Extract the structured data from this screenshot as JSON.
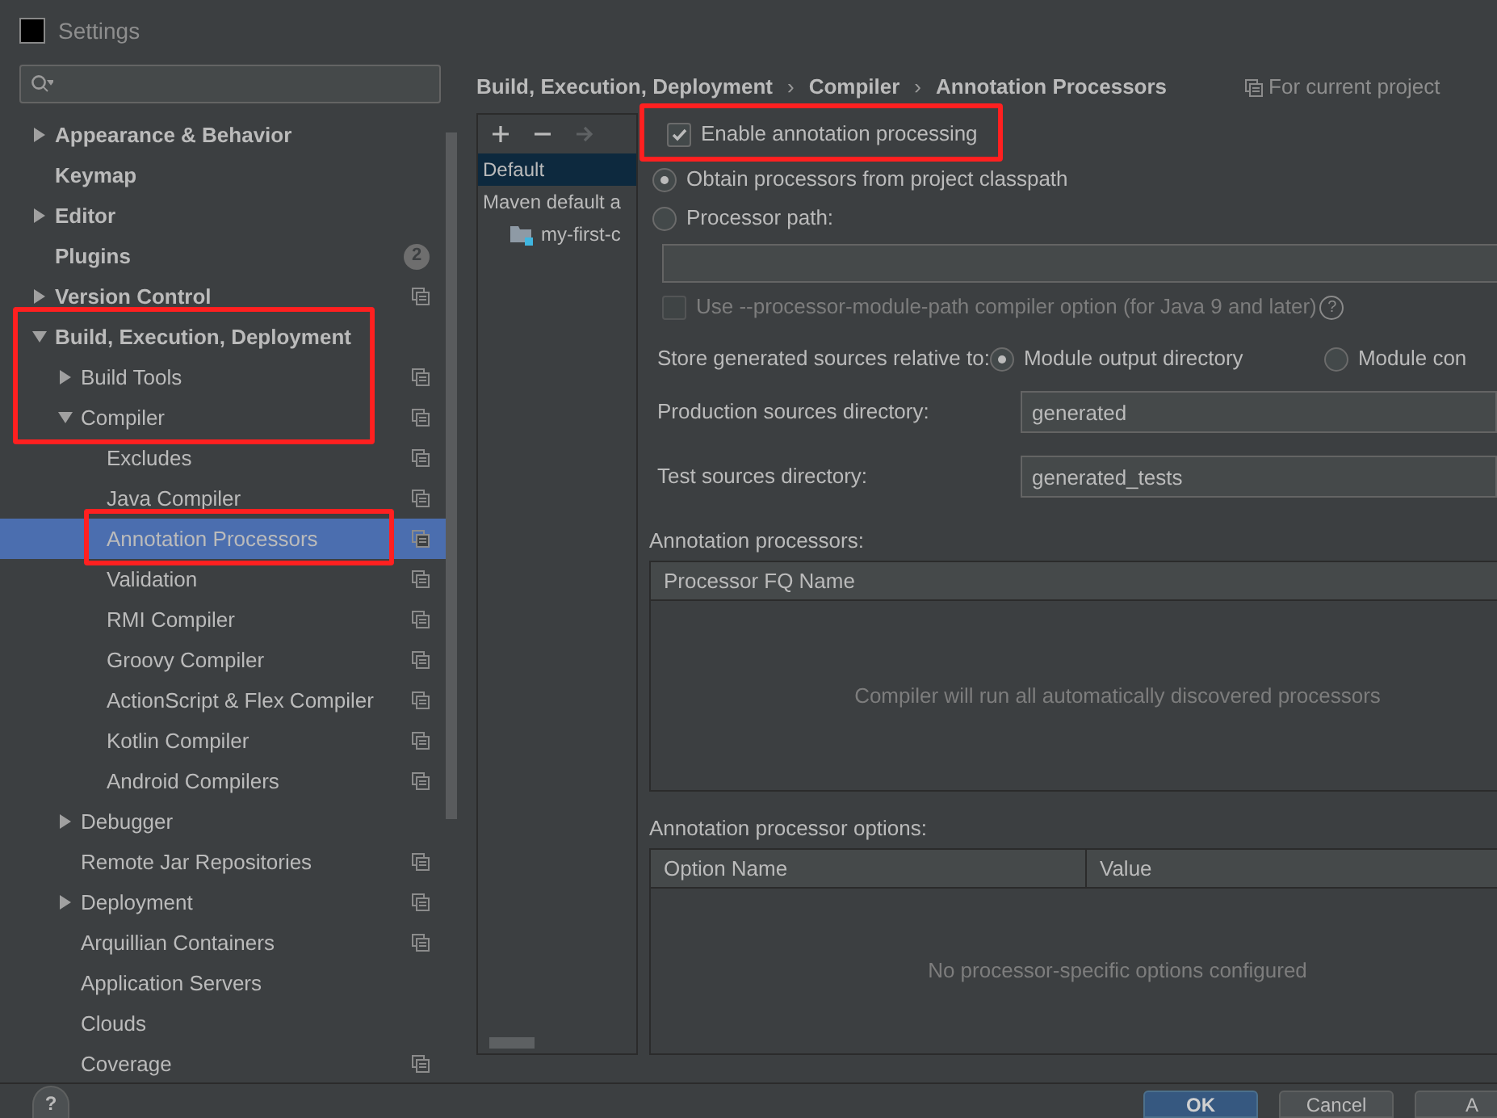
{
  "window": {
    "title": "Settings"
  },
  "tree": [
    {
      "label": "Appearance & Behavior",
      "expanded": false,
      "selected": false,
      "framed": false,
      "project_level": false
    },
    {
      "label": "Keymap",
      "selected": false,
      "framed": false,
      "project_level": false
    },
    {
      "label": "Editor",
      "expanded": false,
      "selected": false,
      "framed": false,
      "project_level": false
    },
    {
      "label": "Plugins",
      "badge": "2",
      "selected": false,
      "framed": false,
      "project_level": false
    },
    {
      "label": "Version Control",
      "expanded": false,
      "selected": false,
      "framed": false,
      "project_level": true
    },
    {
      "label": "Build, Execution, Deployment",
      "expanded": true,
      "selected": false,
      "framed": true,
      "project_level": false,
      "children": [
        {
          "label": "Build Tools",
          "expanded": false,
          "selected": false,
          "framed": true,
          "project_level": true
        },
        {
          "label": "Compiler",
          "expanded": true,
          "selected": false,
          "framed": true,
          "project_level": true,
          "children": [
            {
              "label": "Excludes",
              "selected": false,
              "framed": false,
              "project_level": true
            },
            {
              "label": "Java Compiler",
              "selected": false,
              "framed": false,
              "project_level": true
            },
            {
              "label": "Annotation Processors",
              "selected": true,
              "framed": true,
              "project_level": true
            },
            {
              "label": "Validation",
              "selected": false,
              "framed": false,
              "project_level": true
            },
            {
              "label": "RMI Compiler",
              "selected": false,
              "framed": false,
              "project_level": true
            },
            {
              "label": "Groovy Compiler",
              "selected": false,
              "framed": false,
              "project_level": true
            },
            {
              "label": "ActionScript & Flex Compiler",
              "selected": false,
              "framed": false,
              "project_level": true
            },
            {
              "label": "Kotlin Compiler",
              "selected": false,
              "framed": false,
              "project_level": true
            },
            {
              "label": "Android Compilers",
              "selected": false,
              "framed": false,
              "project_level": true
            }
          ]
        },
        {
          "label": "Debugger",
          "expanded": false,
          "selected": false,
          "framed": false,
          "project_level": false
        },
        {
          "label": "Remote Jar Repositories",
          "selected": false,
          "framed": false,
          "project_level": true
        },
        {
          "label": "Deployment",
          "expanded": false,
          "selected": false,
          "framed": false,
          "project_level": true
        },
        {
          "label": "Arquillian Containers",
          "selected": false,
          "framed": false,
          "project_level": true
        },
        {
          "label": "Application Servers",
          "selected": false,
          "framed": false,
          "project_level": false
        },
        {
          "label": "Clouds",
          "selected": false,
          "framed": false,
          "project_level": false
        },
        {
          "label": "Coverage",
          "selected": false,
          "framed": false,
          "project_level": true
        }
      ]
    }
  ],
  "breadcrumb": [
    "Build, Execution, Deployment",
    "Compiler",
    "Annotation Processors"
  ],
  "breadcrumb_separator": "›",
  "scope_label": "For current project",
  "profiles": {
    "toolbar": [
      {
        "kind": "add",
        "disabled": false
      },
      {
        "kind": "remove",
        "disabled": false
      },
      {
        "kind": "move",
        "disabled": true
      }
    ],
    "items": [
      {
        "label": "Default",
        "selected": true
      },
      {
        "label": "Maven default a",
        "selected": false,
        "children": [
          {
            "label": "my-first-c",
            "selected": false
          }
        ]
      }
    ]
  },
  "enable_processing": {
    "label": "Enable annotation processing",
    "checked": true,
    "framed": true
  },
  "source_options": [
    {
      "label": "Obtain processors from project classpath",
      "selected": true
    },
    {
      "label": "Processor path:",
      "selected": false
    }
  ],
  "module_path_option": {
    "label": "Use --processor-module-path compiler option (for Java 9 and later)",
    "checked": false,
    "disabled": true,
    "help_icon": "?"
  },
  "store_generated": {
    "label": "Store generated sources relative to:",
    "options": [
      {
        "label": "Module output directory",
        "selected": true
      },
      {
        "label": "Module con",
        "selected": false
      }
    ]
  },
  "directories": [
    {
      "label": "Production sources directory:",
      "value": "generated"
    },
    {
      "label": "Test sources directory:",
      "value": "generated_tests"
    }
  ],
  "processors_table": {
    "title": "Annotation processors:",
    "columns": [
      "Processor FQ Name"
    ],
    "empty_text": "Compiler will run all automatically discovered processors"
  },
  "options_table": {
    "title": "Annotation processor options:",
    "columns": [
      "Option Name",
      "Value"
    ],
    "empty_text": "No processor-specific options configured"
  },
  "help": "?",
  "buttons": [
    {
      "label": "OK",
      "kind": "primary"
    },
    {
      "label": "Cancel",
      "kind": "secondary"
    },
    {
      "label": "A",
      "kind": "secondary"
    }
  ]
}
